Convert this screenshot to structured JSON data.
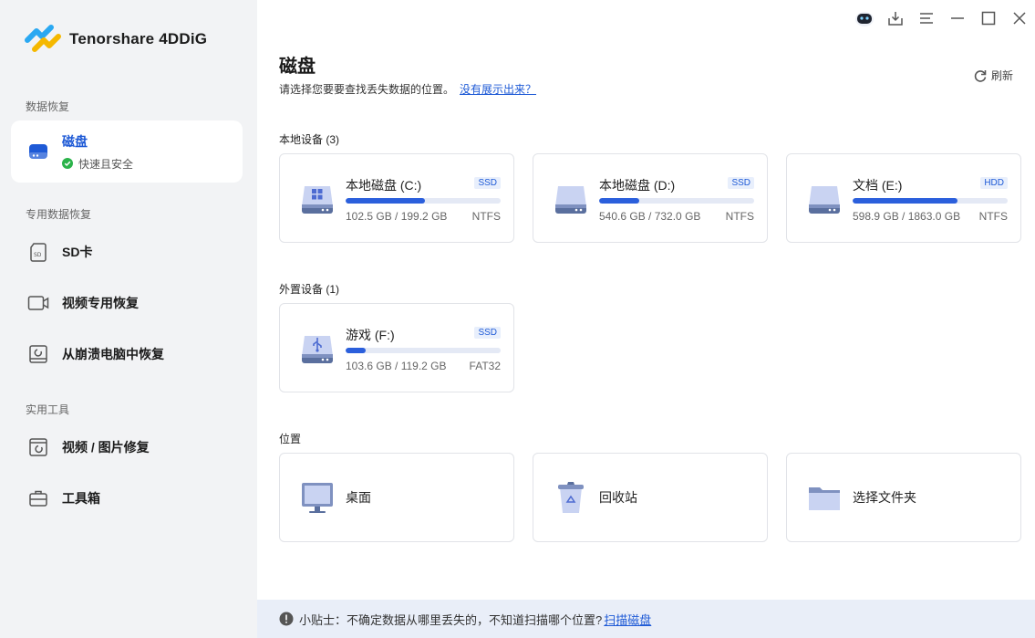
{
  "brand": {
    "name": "Tenorshare 4DDiG"
  },
  "sidebar": {
    "section_recovery": "数据恢复",
    "disk_item": {
      "label": "磁盘",
      "sub": "快速且安全"
    },
    "section_special": "专用数据恢复",
    "special_items": [
      {
        "label": "SD卡",
        "icon": "sd-card-icon"
      },
      {
        "label": "视频专用恢复",
        "icon": "video-icon"
      },
      {
        "label": "从崩溃电脑中恢复",
        "icon": "crashed-pc-icon"
      }
    ],
    "section_tools": "实用工具",
    "tool_items": [
      {
        "label": "视频 / 图片修复",
        "icon": "repair-icon"
      },
      {
        "label": "工具箱",
        "icon": "toolbox-icon"
      }
    ]
  },
  "header": {
    "title": "磁盘",
    "subtitle": "请选择您要要查找丢失数据的位置。",
    "help_link": "没有展示出来？",
    "refresh": "刷新"
  },
  "local_devices": {
    "label": "本地设备 (3)",
    "drives": [
      {
        "name": "本地磁盘 (C:)",
        "type": "SSD",
        "size": "102.5 GB / 199.2 GB",
        "fs": "NTFS",
        "used_fraction": 0.5146
      },
      {
        "name": "本地磁盘 (D:)",
        "type": "SSD",
        "size": "540.6 GB / 732.0 GB",
        "fs": "NTFS",
        "used_fraction": 0.2615
      },
      {
        "name": "文档 (E:)",
        "type": "HDD",
        "size": "598.9 GB / 1863.0 GB",
        "fs": "NTFS",
        "used_fraction": 0.6785
      }
    ]
  },
  "external_devices": {
    "label": "外置设备 (1)",
    "drives": [
      {
        "name": "游戏 (F:)",
        "type": "SSD",
        "size": "103.6 GB / 119.2 GB",
        "fs": "FAT32",
        "used_fraction": 0.1309
      }
    ]
  },
  "locations": {
    "label": "位置",
    "items": [
      {
        "label": "桌面",
        "icon": "desktop-icon"
      },
      {
        "label": "回收站",
        "icon": "recycle-bin-icon"
      },
      {
        "label": "选择文件夹",
        "icon": "folder-icon"
      }
    ]
  },
  "tip": {
    "text": "小贴士：不确定数据从哪里丢失的，不知道扫描哪个位置?",
    "link": "扫描磁盘"
  },
  "colors": {
    "accent": "#1e5ad6",
    "bar_fill": "#2b5fdc",
    "sidebar_bg": "#f2f3f5",
    "tip_bg": "#e9eef8"
  }
}
